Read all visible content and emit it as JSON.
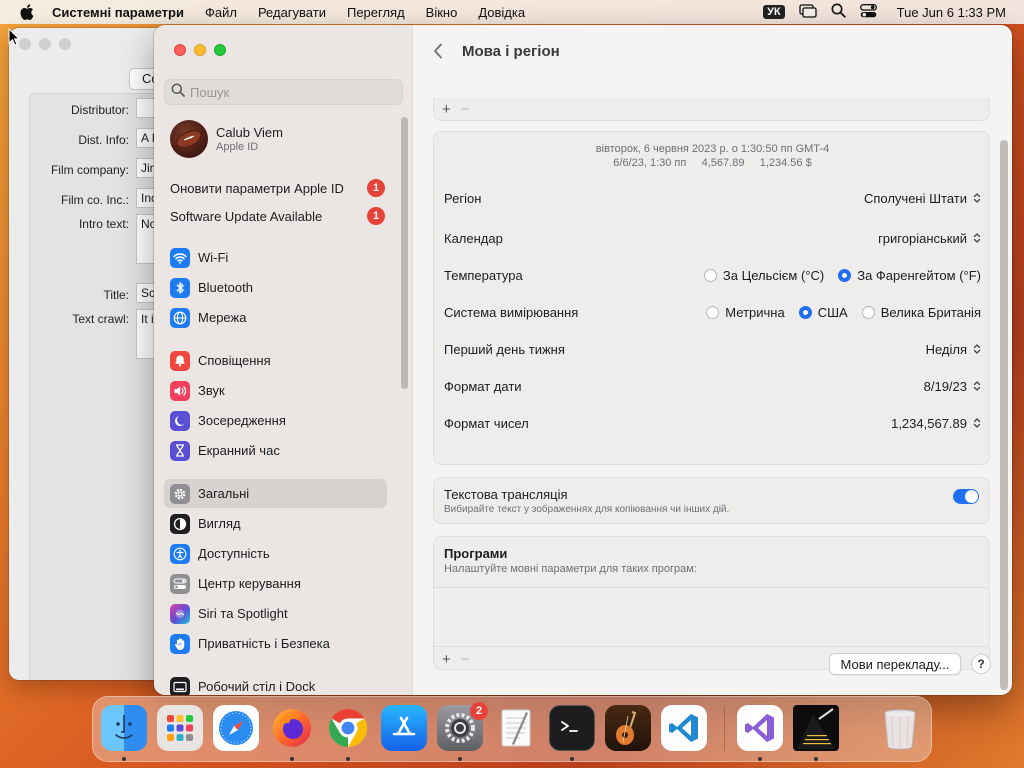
{
  "menubar": {
    "app_name": "Системні параметри",
    "items": [
      "Файл",
      "Редагувати",
      "Перегляд",
      "Вікно",
      "Довідка"
    ],
    "input_source": "УК",
    "clock": "Tue Jun 6  1:33 PM"
  },
  "background_window": {
    "top_button": "Co",
    "fields": [
      {
        "label": "Distributor:",
        "value": ""
      },
      {
        "label": "Dist. Info:",
        "value": "A I"
      },
      {
        "label": "Film company:",
        "value": "Jin"
      },
      {
        "label": "Film co. Inc.:",
        "value": "Inc"
      },
      {
        "label": "Intro text:",
        "value": "No clo"
      },
      {
        "label": "Title:",
        "value": "Sc"
      },
      {
        "label": "Text crawl:",
        "value": "It i dir"
      }
    ]
  },
  "sidebar": {
    "search_placeholder": "Пошук",
    "profile": {
      "name": "Calub Viem",
      "subtitle": "Apple ID"
    },
    "notices": [
      {
        "label": "Оновити параметри Apple ID",
        "badge": "1"
      },
      {
        "label": "Software Update Available",
        "badge": "1"
      }
    ],
    "items": [
      {
        "label": "Wi-Fi",
        "icon": "wifi-icon",
        "color": "#1e7cf2"
      },
      {
        "label": "Bluetooth",
        "icon": "bluetooth-icon",
        "color": "#1e7cf2"
      },
      {
        "label": "Мережа",
        "icon": "globe-icon",
        "color": "#1e7cf2"
      },
      {
        "label": "Сповіщення",
        "icon": "bell-icon",
        "color": "#f0463c"
      },
      {
        "label": "Звук",
        "icon": "speaker-icon",
        "color": "#f0405e"
      },
      {
        "label": "Зосередження",
        "icon": "moon-icon",
        "color": "#5b4fd6"
      },
      {
        "label": "Екранний час",
        "icon": "hourglass-icon",
        "color": "#5b4fd6"
      },
      {
        "label": "Загальні",
        "icon": "gear-icon",
        "color": "#8e8e93",
        "selected": true
      },
      {
        "label": "Вигляд",
        "icon": "appearance-icon",
        "color": "#1d1d1f"
      },
      {
        "label": "Доступність",
        "icon": "accessibility-icon",
        "color": "#1e7cf2"
      },
      {
        "label": "Центр керування",
        "icon": "control-center-icon",
        "color": "#8e8e93"
      },
      {
        "label": "Siri та Spotlight",
        "icon": "siri-icon",
        "color": "#c43ad8"
      },
      {
        "label": "Приватність і Безпека",
        "icon": "hand-icon",
        "color": "#1e7cf2"
      },
      {
        "label": "Робочий стіл і Dock",
        "icon": "desktop-icon",
        "color": "#1d1d1f"
      }
    ]
  },
  "content": {
    "title": "Мова і регіон",
    "preview_line1": "вівторок, 6 червня 2023 р. о 1:30:50 пп GMT-4",
    "preview_line2": "6/6/23, 1:30 пп     4,567.89     1,234.56 $",
    "region": {
      "label": "Регіон",
      "value": "Сполучені Штати"
    },
    "calendar": {
      "label": "Календар",
      "value": "григоріанський"
    },
    "temperature": {
      "label": "Температура",
      "options": [
        "За Цельсієм (°C)",
        "За Фаренгейтом (°F)"
      ],
      "selected": 1
    },
    "measurement": {
      "label": "Система вимірювання",
      "options": [
        "Метрична",
        "США",
        "Велика Британія"
      ],
      "selected": 1
    },
    "first_day": {
      "label": "Перший день тижня",
      "value": "Неділя"
    },
    "date_format": {
      "label": "Формат дати",
      "value": "8/19/23"
    },
    "number_format": {
      "label": "Формат чисел",
      "value": "1,234,567.89"
    },
    "live_text": {
      "label": "Текстова трансляція",
      "description": "Вибирайте текст у зображеннях для копіювання чи інших дій.",
      "enabled": true
    },
    "apps": {
      "title": "Програми",
      "description": "Налаштуйте мовні параметри для таких програм:"
    },
    "plus": "+",
    "minus": "−",
    "translation_button": "Мови перекладу...",
    "help": "?"
  },
  "dock": {
    "items": [
      {
        "name": "finder-icon",
        "running": true
      },
      {
        "name": "launchpad-icon",
        "running": false
      },
      {
        "name": "safari-icon",
        "running": false
      },
      {
        "name": "firefox-icon",
        "running": true
      },
      {
        "name": "chrome-icon",
        "running": true
      },
      {
        "name": "app-store-icon",
        "running": false
      },
      {
        "name": "system-settings-icon",
        "running": true,
        "badge": "2"
      },
      {
        "name": "textedit-icon",
        "running": false
      },
      {
        "name": "terminal-icon",
        "running": true
      },
      {
        "name": "garageband-icon",
        "running": false
      },
      {
        "name": "vscode-icon",
        "running": false
      },
      {
        "name": "visual-studio-icon",
        "running": true
      },
      {
        "name": "script-app-icon",
        "running": true
      },
      {
        "name": "trash-icon",
        "running": false
      }
    ]
  }
}
